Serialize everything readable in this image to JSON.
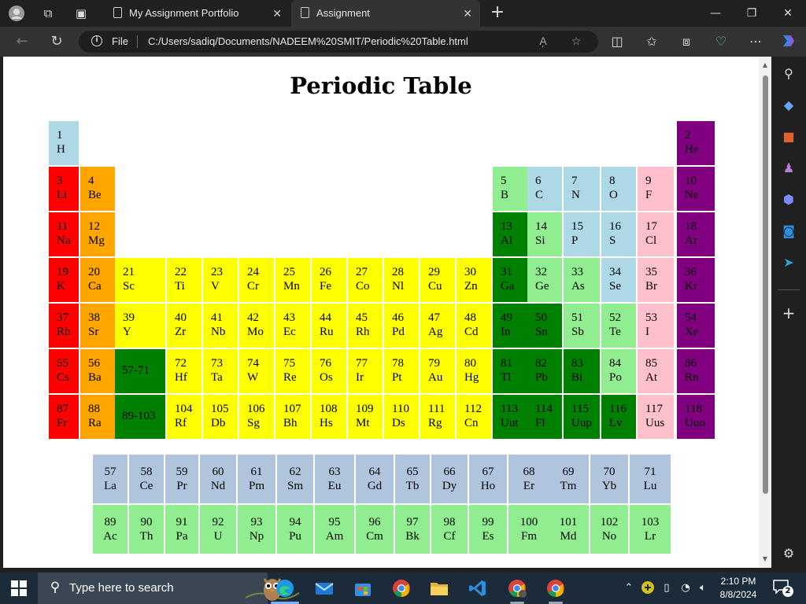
{
  "browser": {
    "tabs": [
      {
        "title": "My Assignment Portfolio",
        "active": false
      },
      {
        "title": "Assignment",
        "active": true
      }
    ],
    "address": {
      "scheme_label": "File",
      "url": "C:/Users/sadiq/Documents/NADEEM%20SMIT/Periodic%20Table.html"
    }
  },
  "page": {
    "title": "Periodic Table"
  },
  "colors": {
    "hydrogen": "#add8e6",
    "alkali": "#ff0000",
    "alkaline_earth": "#ffa500",
    "transition": "#ffff00",
    "metal": "#008000",
    "metalloid": "#90ee90",
    "nonmetal": "#add8e6",
    "halogen": "#ffc0cb",
    "noble_gas": "#800080",
    "lanthanide": "#b0c4de",
    "actinide": "#90ee90"
  },
  "table": {
    "rows": [
      [
        {
          "n": "1",
          "s": "H",
          "c": "hyd",
          "col": 1
        },
        {
          "n": "2",
          "s": "He",
          "c": "noble",
          "col": 18
        }
      ],
      [
        {
          "n": "3",
          "s": "Li",
          "c": "alk",
          "col": 1
        },
        {
          "n": "4",
          "s": "Be",
          "c": "alkearth",
          "col": 2
        },
        {
          "n": "5",
          "s": "B",
          "c": "metalloid",
          "col": 13
        },
        {
          "n": "6",
          "s": "C",
          "c": "nonmetal",
          "col": 14
        },
        {
          "n": "7",
          "s": "N",
          "c": "nonmetal",
          "col": 15
        },
        {
          "n": "8",
          "s": "O",
          "c": "nonmetal",
          "col": 16
        },
        {
          "n": "9",
          "s": "F",
          "c": "halogen",
          "col": 17
        },
        {
          "n": "10",
          "s": "Ne",
          "c": "noble",
          "col": 18
        }
      ],
      [
        {
          "n": "11",
          "s": "Na",
          "c": "alk",
          "col": 1
        },
        {
          "n": "12",
          "s": "Mg",
          "c": "alkearth",
          "col": 2
        },
        {
          "n": "13",
          "s": "Al",
          "c": "metal",
          "col": 13
        },
        {
          "n": "14",
          "s": "Si",
          "c": "metalloid",
          "col": 14
        },
        {
          "n": "15",
          "s": "P",
          "c": "nonmetal",
          "col": 15
        },
        {
          "n": "16",
          "s": "S",
          "c": "nonmetal",
          "col": 16
        },
        {
          "n": "17",
          "s": "Cl",
          "c": "halogen",
          "col": 17
        },
        {
          "n": "18",
          "s": "Ar",
          "c": "noble",
          "col": 18
        }
      ],
      [
        {
          "n": "19",
          "s": "K",
          "c": "alk",
          "col": 1
        },
        {
          "n": "20",
          "s": "Ca",
          "c": "alkearth",
          "col": 2
        },
        {
          "n": "21",
          "s": "Sc",
          "c": "trans",
          "col": 3
        },
        {
          "n": "22",
          "s": "Ti",
          "c": "trans",
          "col": 4
        },
        {
          "n": "23",
          "s": "V",
          "c": "trans",
          "col": 5
        },
        {
          "n": "24",
          "s": "Cr",
          "c": "trans",
          "col": 6
        },
        {
          "n": "25",
          "s": "Mn",
          "c": "trans",
          "col": 7
        },
        {
          "n": "26",
          "s": "Fe",
          "c": "trans",
          "col": 8
        },
        {
          "n": "27",
          "s": "Co",
          "c": "trans",
          "col": 9
        },
        {
          "n": "28",
          "s": "Nl",
          "c": "trans",
          "col": 10
        },
        {
          "n": "29",
          "s": "Cu",
          "c": "trans",
          "col": 11
        },
        {
          "n": "30",
          "s": "Zn",
          "c": "trans",
          "col": 12
        },
        {
          "n": "31",
          "s": "Ga",
          "c": "metal",
          "col": 13
        },
        {
          "n": "32",
          "s": "Ge",
          "c": "metalloid",
          "col": 14
        },
        {
          "n": "33",
          "s": "As",
          "c": "metalloid",
          "col": 15
        },
        {
          "n": "34",
          "s": "Se",
          "c": "nonmetal",
          "col": 16
        },
        {
          "n": "35",
          "s": "Br",
          "c": "halogen",
          "col": 17
        },
        {
          "n": "36",
          "s": "Kr",
          "c": "noble",
          "col": 18
        }
      ],
      [
        {
          "n": "37",
          "s": "Rb",
          "c": "alk",
          "col": 1
        },
        {
          "n": "38",
          "s": "Sr",
          "c": "alkearth",
          "col": 2
        },
        {
          "n": "39",
          "s": "Y",
          "c": "trans",
          "col": 3
        },
        {
          "n": "40",
          "s": "Zr",
          "c": "trans",
          "col": 4
        },
        {
          "n": "41",
          "s": "Nb",
          "c": "trans",
          "col": 5
        },
        {
          "n": "42",
          "s": "Mo",
          "c": "trans",
          "col": 6
        },
        {
          "n": "43",
          "s": "Ec",
          "c": "trans",
          "col": 7
        },
        {
          "n": "44",
          "s": "Ru",
          "c": "trans",
          "col": 8
        },
        {
          "n": "45",
          "s": "Rh",
          "c": "trans",
          "col": 9
        },
        {
          "n": "46",
          "s": "Pd",
          "c": "trans",
          "col": 10
        },
        {
          "n": "47",
          "s": "Ag",
          "c": "trans",
          "col": 11
        },
        {
          "n": "48",
          "s": "Cd",
          "c": "trans",
          "col": 12
        },
        {
          "n": "49",
          "s": "In",
          "c": "metal",
          "col": 13
        },
        {
          "n": "50",
          "s": "Sn",
          "c": "metal",
          "col": 14
        },
        {
          "n": "51",
          "s": "Sb",
          "c": "metalloid",
          "col": 15
        },
        {
          "n": "52",
          "s": "Te",
          "c": "metalloid",
          "col": 16
        },
        {
          "n": "53",
          "s": "I",
          "c": "halogen",
          "col": 17
        },
        {
          "n": "54",
          "s": "Xe",
          "c": "noble",
          "col": 18
        }
      ],
      [
        {
          "n": "55",
          "s": "Cs",
          "c": "alk",
          "col": 1
        },
        {
          "n": "56",
          "s": "Ba",
          "c": "alkearth",
          "col": 2
        },
        {
          "n": "57-71",
          "s": "",
          "c": "metal",
          "col": 3
        },
        {
          "n": "72",
          "s": "Hf",
          "c": "trans",
          "col": 4
        },
        {
          "n": "73",
          "s": "Ta",
          "c": "trans",
          "col": 5
        },
        {
          "n": "74",
          "s": "W",
          "c": "trans",
          "col": 6
        },
        {
          "n": "75",
          "s": "Re",
          "c": "trans",
          "col": 7
        },
        {
          "n": "76",
          "s": "Os",
          "c": "trans",
          "col": 8
        },
        {
          "n": "77",
          "s": "Ir",
          "c": "trans",
          "col": 9
        },
        {
          "n": "78",
          "s": "Pt",
          "c": "trans",
          "col": 10
        },
        {
          "n": "79",
          "s": "Au",
          "c": "trans",
          "col": 11
        },
        {
          "n": "80",
          "s": "Hg",
          "c": "trans",
          "col": 12
        },
        {
          "n": "81",
          "s": "Tl",
          "c": "metal",
          "col": 13
        },
        {
          "n": "82",
          "s": "Pb",
          "c": "metal",
          "col": 14
        },
        {
          "n": "83",
          "s": "Bi",
          "c": "metal",
          "col": 15
        },
        {
          "n": "84",
          "s": "Po",
          "c": "metalloid",
          "col": 16
        },
        {
          "n": "85",
          "s": "At",
          "c": "halogen",
          "col": 17
        },
        {
          "n": "86",
          "s": "Rn",
          "c": "noble",
          "col": 18
        }
      ],
      [
        {
          "n": "87",
          "s": "Fr",
          "c": "alk",
          "col": 1
        },
        {
          "n": "88",
          "s": "Ra",
          "c": "alkearth",
          "col": 2
        },
        {
          "n": "89-103",
          "s": "",
          "c": "metal",
          "col": 3
        },
        {
          "n": "104",
          "s": "Rf",
          "c": "trans",
          "col": 4
        },
        {
          "n": "105",
          "s": "Db",
          "c": "trans",
          "col": 5
        },
        {
          "n": "106",
          "s": "Sg",
          "c": "trans",
          "col": 6
        },
        {
          "n": "107",
          "s": "Bh",
          "c": "trans",
          "col": 7
        },
        {
          "n": "108",
          "s": "Hs",
          "c": "trans",
          "col": 8
        },
        {
          "n": "109",
          "s": "Mt",
          "c": "trans",
          "col": 9
        },
        {
          "n": "110",
          "s": "Ds",
          "c": "trans",
          "col": 10
        },
        {
          "n": "111",
          "s": "Rg",
          "c": "trans",
          "col": 11
        },
        {
          "n": "112",
          "s": "Cn",
          "c": "trans",
          "col": 12
        },
        {
          "n": "113",
          "s": "Uut",
          "c": "metal",
          "col": 13
        },
        {
          "n": "114",
          "s": "Fl",
          "c": "metal",
          "col": 14
        },
        {
          "n": "115",
          "s": "Uup",
          "c": "metal",
          "col": 15
        },
        {
          "n": "116",
          "s": "Lv",
          "c": "metal",
          "col": 16
        },
        {
          "n": "117",
          "s": "Uus",
          "c": "halogen",
          "col": 17
        },
        {
          "n": "118",
          "s": "Uuo",
          "c": "noble",
          "col": 18
        }
      ]
    ],
    "lanthanides": [
      {
        "n": "57",
        "s": "La"
      },
      {
        "n": "58",
        "s": "Ce"
      },
      {
        "n": "59",
        "s": "Pr"
      },
      {
        "n": "60",
        "s": "Nd"
      },
      {
        "n": "61",
        "s": "Pm"
      },
      {
        "n": "62",
        "s": "Sm"
      },
      {
        "n": "63",
        "s": "Eu"
      },
      {
        "n": "64",
        "s": "Gd"
      },
      {
        "n": "65",
        "s": "Tb"
      },
      {
        "n": "66",
        "s": "Dy"
      },
      {
        "n": "67",
        "s": "Ho"
      },
      {
        "n": "68",
        "s": "Er"
      },
      {
        "n": "69",
        "s": "Tm"
      },
      {
        "n": "70",
        "s": "Yb"
      },
      {
        "n": "71",
        "s": "Lu"
      }
    ],
    "actinides": [
      {
        "n": "89",
        "s": "Ac"
      },
      {
        "n": "90",
        "s": "Th"
      },
      {
        "n": "91",
        "s": "Pa"
      },
      {
        "n": "92",
        "s": "U"
      },
      {
        "n": "93",
        "s": "Np"
      },
      {
        "n": "94",
        "s": "Pu"
      },
      {
        "n": "95",
        "s": "Am"
      },
      {
        "n": "96",
        "s": "Cm"
      },
      {
        "n": "97",
        "s": "Bk"
      },
      {
        "n": "98",
        "s": "Cf"
      },
      {
        "n": "99",
        "s": "Es"
      },
      {
        "n": "100",
        "s": "Fm"
      },
      {
        "n": "101",
        "s": "Md"
      },
      {
        "n": "102",
        "s": "No"
      },
      {
        "n": "103",
        "s": "Lr"
      }
    ]
  },
  "taskbar": {
    "search_placeholder": "Type here to search",
    "time": "2:10 PM",
    "date": "8/8/2024",
    "notification_count": "2",
    "pinned": [
      "edge-icon",
      "mail-icon",
      "store-icon",
      "chrome-icon",
      "file-explorer-icon",
      "vscode-icon",
      "chrome-profile-icon",
      "chrome-icon"
    ]
  }
}
